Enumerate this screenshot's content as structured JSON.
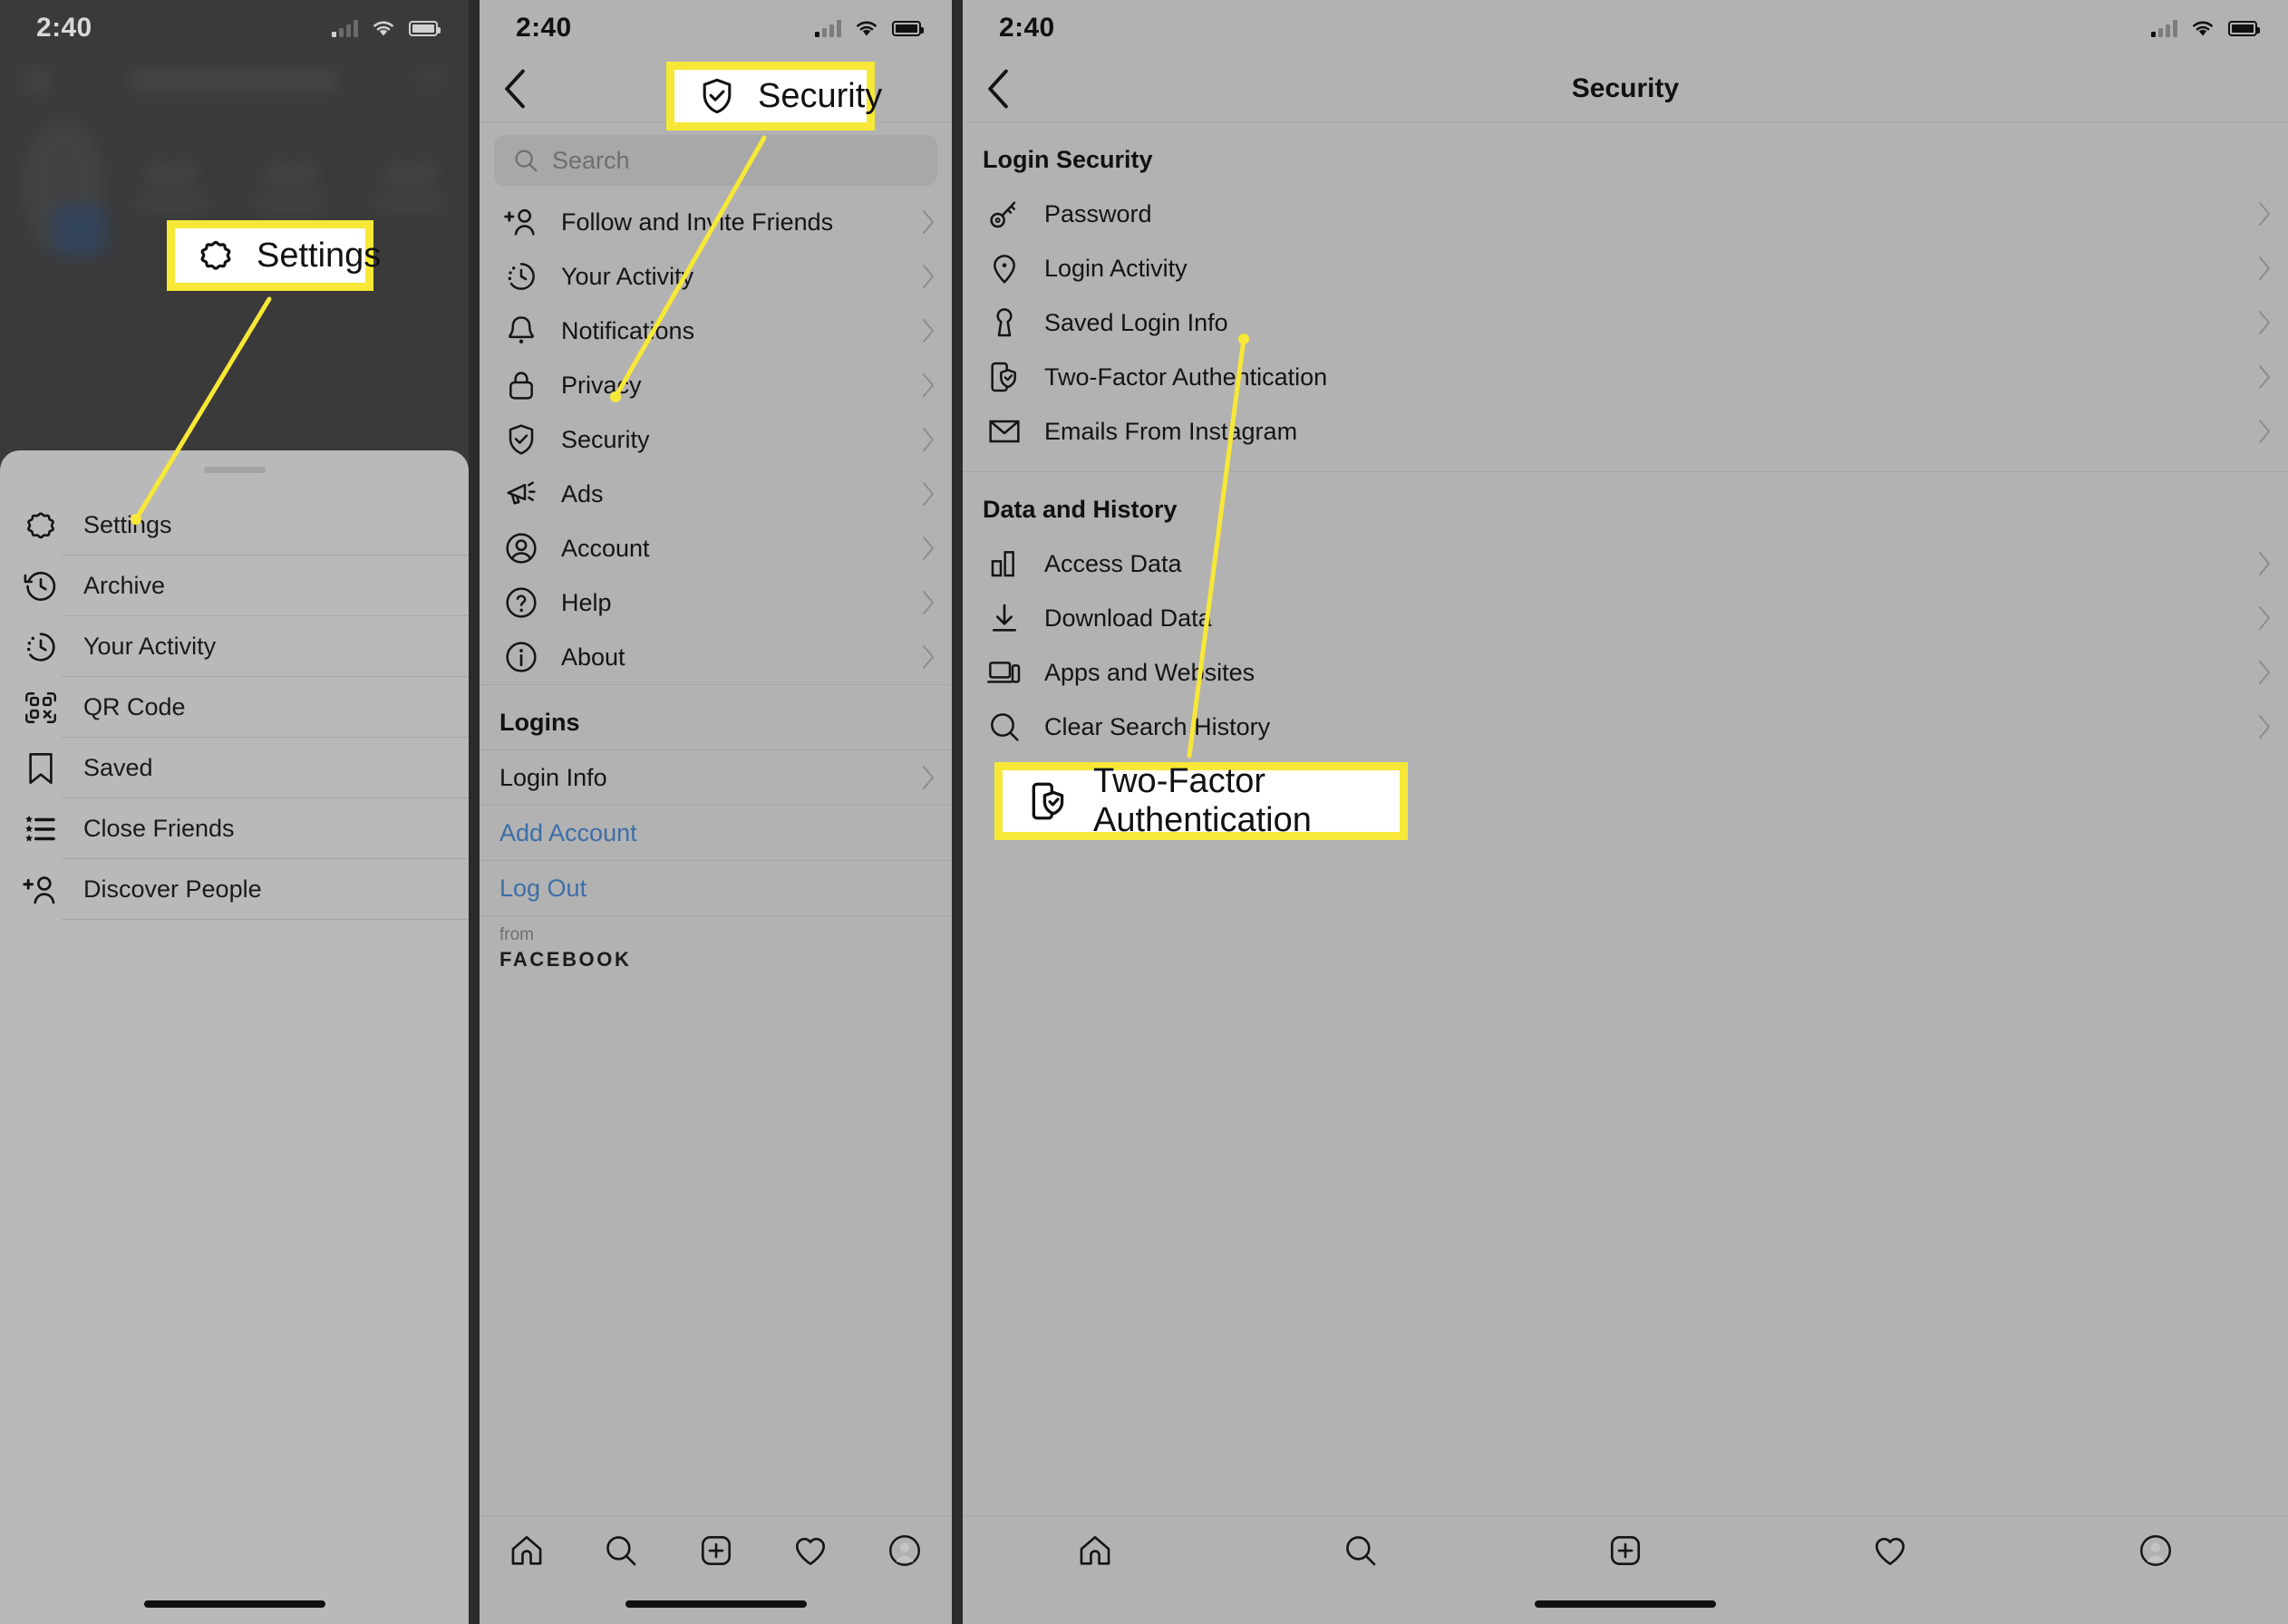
{
  "status_bar": {
    "time": "2:40"
  },
  "callouts": [
    {
      "id": "settings",
      "label": "Settings",
      "icon": "gear-icon"
    },
    {
      "id": "security",
      "label": "Security",
      "icon": "shield-check-icon"
    },
    {
      "id": "two-factor",
      "label": "Two-Factor Authentication",
      "icon": "phone-shield-icon"
    }
  ],
  "left_panel": {
    "sheet_items": [
      {
        "label": "Settings",
        "icon": "gear-icon"
      },
      {
        "label": "Archive",
        "icon": "archive-clock-icon"
      },
      {
        "label": "Your Activity",
        "icon": "activity-clock-icon"
      },
      {
        "label": "QR Code",
        "icon": "qr-code-icon"
      },
      {
        "label": "Saved",
        "icon": "bookmark-icon"
      },
      {
        "label": "Close Friends",
        "icon": "star-list-icon"
      },
      {
        "label": "Discover People",
        "icon": "add-person-icon"
      }
    ]
  },
  "mid_panel": {
    "back_label": "Back",
    "search": {
      "placeholder": "Search",
      "icon": "search-icon"
    },
    "items": [
      {
        "label": "Follow and Invite Friends",
        "icon": "add-person-icon"
      },
      {
        "label": "Your Activity",
        "icon": "activity-clock-icon"
      },
      {
        "label": "Notifications",
        "icon": "bell-icon"
      },
      {
        "label": "Privacy",
        "icon": "lock-icon"
      },
      {
        "label": "Security",
        "icon": "shield-check-icon"
      },
      {
        "label": "Ads",
        "icon": "megaphone-icon"
      },
      {
        "label": "Account",
        "icon": "account-circle-icon"
      },
      {
        "label": "Help",
        "icon": "question-circle-icon"
      },
      {
        "label": "About",
        "icon": "info-circle-icon"
      }
    ],
    "logins_header": "Logins",
    "login_info": "Login Info",
    "add_account": "Add Account",
    "log_out": "Log Out",
    "from_label": "from",
    "brand_label": "FACEBOOK"
  },
  "right_panel": {
    "title": "Security",
    "sections": [
      {
        "header": "Login Security",
        "items": [
          {
            "label": "Password",
            "icon": "key-icon"
          },
          {
            "label": "Login Activity",
            "icon": "location-pin-icon"
          },
          {
            "label": "Saved Login Info",
            "icon": "keyhole-icon"
          },
          {
            "label": "Two-Factor Authentication",
            "icon": "phone-shield-icon"
          },
          {
            "label": "Emails From Instagram",
            "icon": "envelope-icon"
          }
        ]
      },
      {
        "header": "Data and History",
        "items": [
          {
            "label": "Access Data",
            "icon": "bar-chart-icon"
          },
          {
            "label": "Download Data",
            "icon": "download-icon"
          },
          {
            "label": "Apps and Websites",
            "icon": "devices-icon"
          },
          {
            "label": "Clear Search History",
            "icon": "search-icon"
          }
        ]
      }
    ]
  },
  "tab_bar": {
    "tabs": [
      {
        "name": "home",
        "icon": "home-icon"
      },
      {
        "name": "search",
        "icon": "search-icon"
      },
      {
        "name": "create",
        "icon": "plus-square-icon"
      },
      {
        "name": "activity",
        "icon": "heart-icon"
      },
      {
        "name": "profile",
        "icon": "avatar-icon"
      }
    ]
  },
  "colors": {
    "highlight": "#F7E837",
    "link": "#3D6EA8",
    "panel_bg": "#B2B2B2",
    "sheet_bg": "#B9B9B9",
    "dark_bg": "#3A3A3A"
  }
}
